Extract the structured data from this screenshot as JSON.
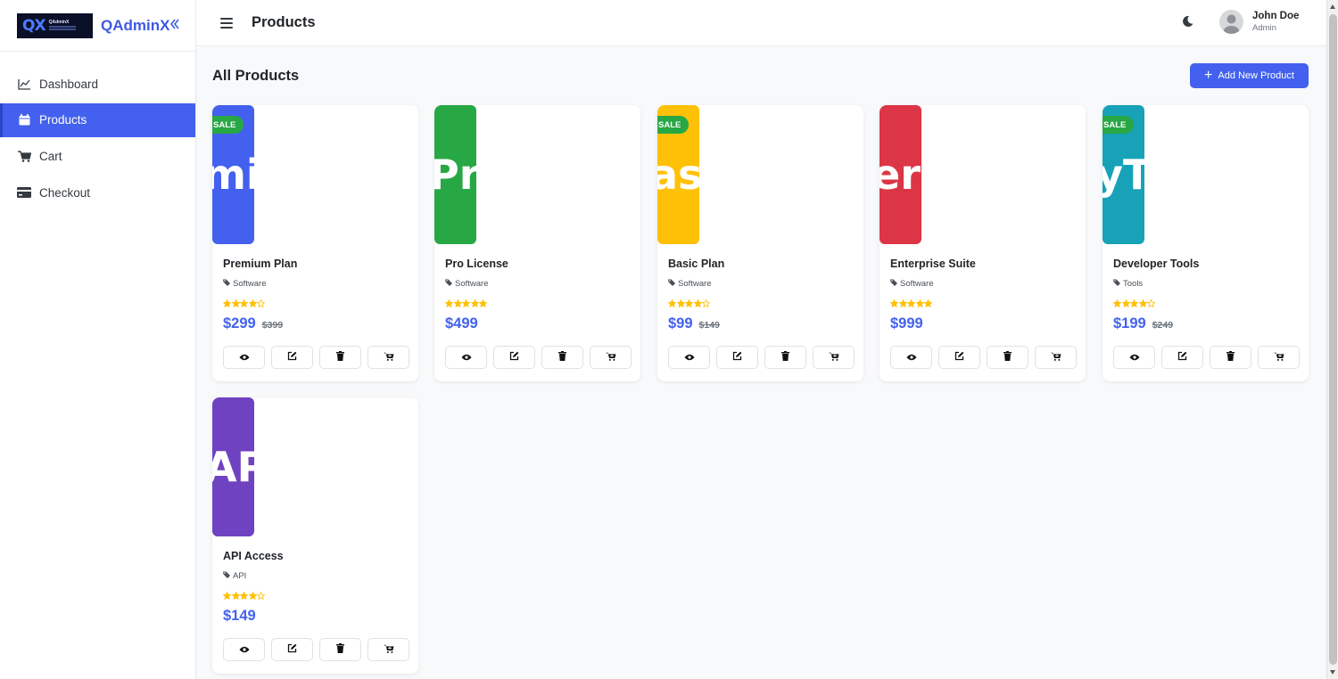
{
  "brand": {
    "name": "QAdminX",
    "collapse_icon": "chevron-double-left-icon",
    "logo_letters": "QX",
    "logo_text": "QAdminX"
  },
  "sidebar": {
    "items": [
      {
        "label": "Dashboard",
        "icon": "chart-line-icon",
        "active": false
      },
      {
        "label": "Products",
        "icon": "box-icon",
        "active": true
      },
      {
        "label": "Cart",
        "icon": "cart-icon",
        "active": false
      },
      {
        "label": "Checkout",
        "icon": "credit-card-icon",
        "active": false
      }
    ]
  },
  "header": {
    "title": "Products",
    "user": {
      "name": "John Doe",
      "role": "Admin"
    }
  },
  "main": {
    "section_title": "All Products",
    "add_button_label": "Add New Product",
    "products": [
      {
        "name": "Premium Plan",
        "category": "Software",
        "rating": 4,
        "price": "$299",
        "old_price": "$399",
        "sale": true,
        "sale_label": "SALE",
        "thumb_text": "mi",
        "color": "#4361ee"
      },
      {
        "name": "Pro License",
        "category": "Software",
        "rating": 5,
        "price": "$499",
        "old_price": "",
        "sale": false,
        "sale_label": "",
        "thumb_text": "Pr",
        "color": "#28a745"
      },
      {
        "name": "Basic Plan",
        "category": "Software",
        "rating": 4,
        "price": "$99",
        "old_price": "$149",
        "sale": true,
        "sale_label": "SALE",
        "thumb_text": "as",
        "color": "#ffc107"
      },
      {
        "name": "Enterprise Suite",
        "category": "Software",
        "rating": 5,
        "price": "$999",
        "old_price": "",
        "sale": false,
        "sale_label": "",
        "thumb_text": "erp",
        "color": "#dc3545"
      },
      {
        "name": "Developer Tools",
        "category": "Tools",
        "rating": 4,
        "price": "$199",
        "old_price": "$249",
        "sale": true,
        "sale_label": "SALE",
        "thumb_text": "yTo",
        "color": "#17a2b8"
      },
      {
        "name": "API Access",
        "category": "API",
        "rating": 4,
        "price": "$149",
        "old_price": "",
        "sale": false,
        "sale_label": "",
        "thumb_text": "AP",
        "color": "#6f42c1"
      }
    ]
  },
  "colors": {
    "primary": "#4361ee",
    "sale": "#28a745",
    "star": "#ffc107"
  }
}
